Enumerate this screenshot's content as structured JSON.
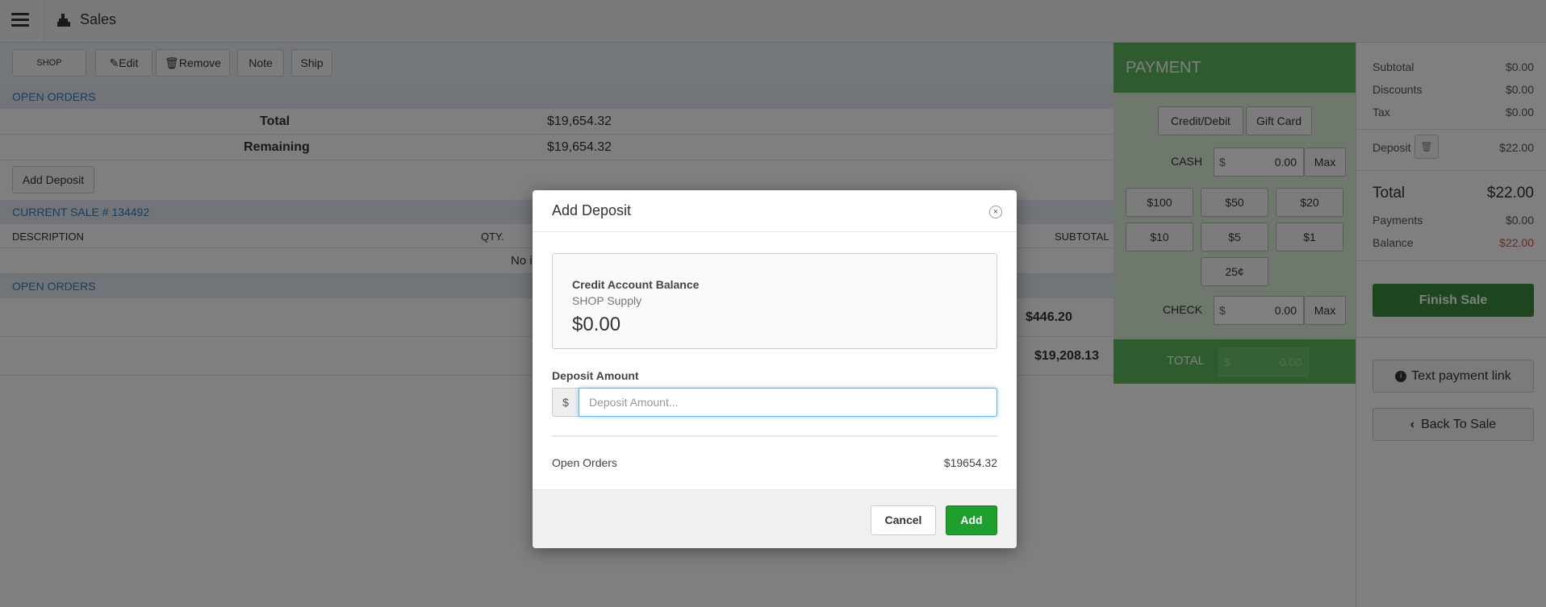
{
  "app": {
    "title": "Sales"
  },
  "toolbar": {
    "customer": "SHOP SUPPLY",
    "edit": "Edit",
    "remove": "Remove",
    "note": "Note",
    "ship": "Ship"
  },
  "open_orders_top": {
    "heading": "OPEN ORDERS",
    "total_label": "Total",
    "total_value": "$19,654.32",
    "remaining_label": "Remaining",
    "remaining_value": "$19,654.32",
    "add_deposit": "Add Deposit"
  },
  "current_sale": {
    "heading": "CURRENT SALE # 134492",
    "columns": {
      "description": "DESCRIPTION",
      "qty": "QTY.",
      "subtotal": "SUBTOTAL"
    },
    "empty_text": "No i"
  },
  "open_orders_bottom": {
    "heading": "OPEN ORDERS",
    "rows": [
      {
        "value": "$446.20"
      },
      {
        "value": "$19,208.13"
      }
    ]
  },
  "payment": {
    "heading": "PAYMENT",
    "tabs": [
      "Credit/Debit",
      "Gift Card"
    ],
    "cash_label": "CASH",
    "currency": "$",
    "cash_value": "0.00",
    "max": "Max",
    "quick_cash": [
      "$100",
      "$50",
      "$20",
      "$10",
      "$5",
      "$1",
      "25¢"
    ],
    "check_label": "CHECK",
    "check_value": "0.00",
    "total_label": "TOTAL",
    "total_value": "0.00"
  },
  "summary": {
    "subtotal_label": "Subtotal",
    "subtotal_value": "$0.00",
    "discounts_label": "Discounts",
    "discounts_value": "$0.00",
    "tax_label": "Tax",
    "tax_value": "$0.00",
    "deposit_label": "Deposit",
    "deposit_value": "$22.00",
    "total_label": "Total",
    "total_value": "$22.00",
    "payments_label": "Payments",
    "payments_value": "$0.00",
    "balance_label": "Balance",
    "balance_value": "$22.00",
    "finish_sale": "Finish Sale",
    "text_payment_link": "Text payment link",
    "back_to_sale": "Back To Sale"
  },
  "modal": {
    "title": "Add Deposit",
    "close": "×",
    "credit_title": "Credit Account Balance",
    "credit_customer": "SHOP Supply",
    "credit_amount": "$0.00",
    "deposit_label": "Deposit Amount",
    "deposit_currency": "$",
    "deposit_placeholder": "Deposit Amount...",
    "open_orders_label": "Open Orders",
    "open_orders_value": "$19654.32",
    "cancel": "Cancel",
    "add": "Add"
  },
  "colors": {
    "payment_green": "#5cb85c",
    "add_button": "#1e9e2c",
    "link_blue": "#337ab7",
    "balance_red": "#d9534f"
  },
  "icons": [
    "hamburger-icon",
    "sales-icon",
    "pencil-icon",
    "trash-icon",
    "close-icon",
    "info-icon",
    "chevron-left-icon"
  ]
}
